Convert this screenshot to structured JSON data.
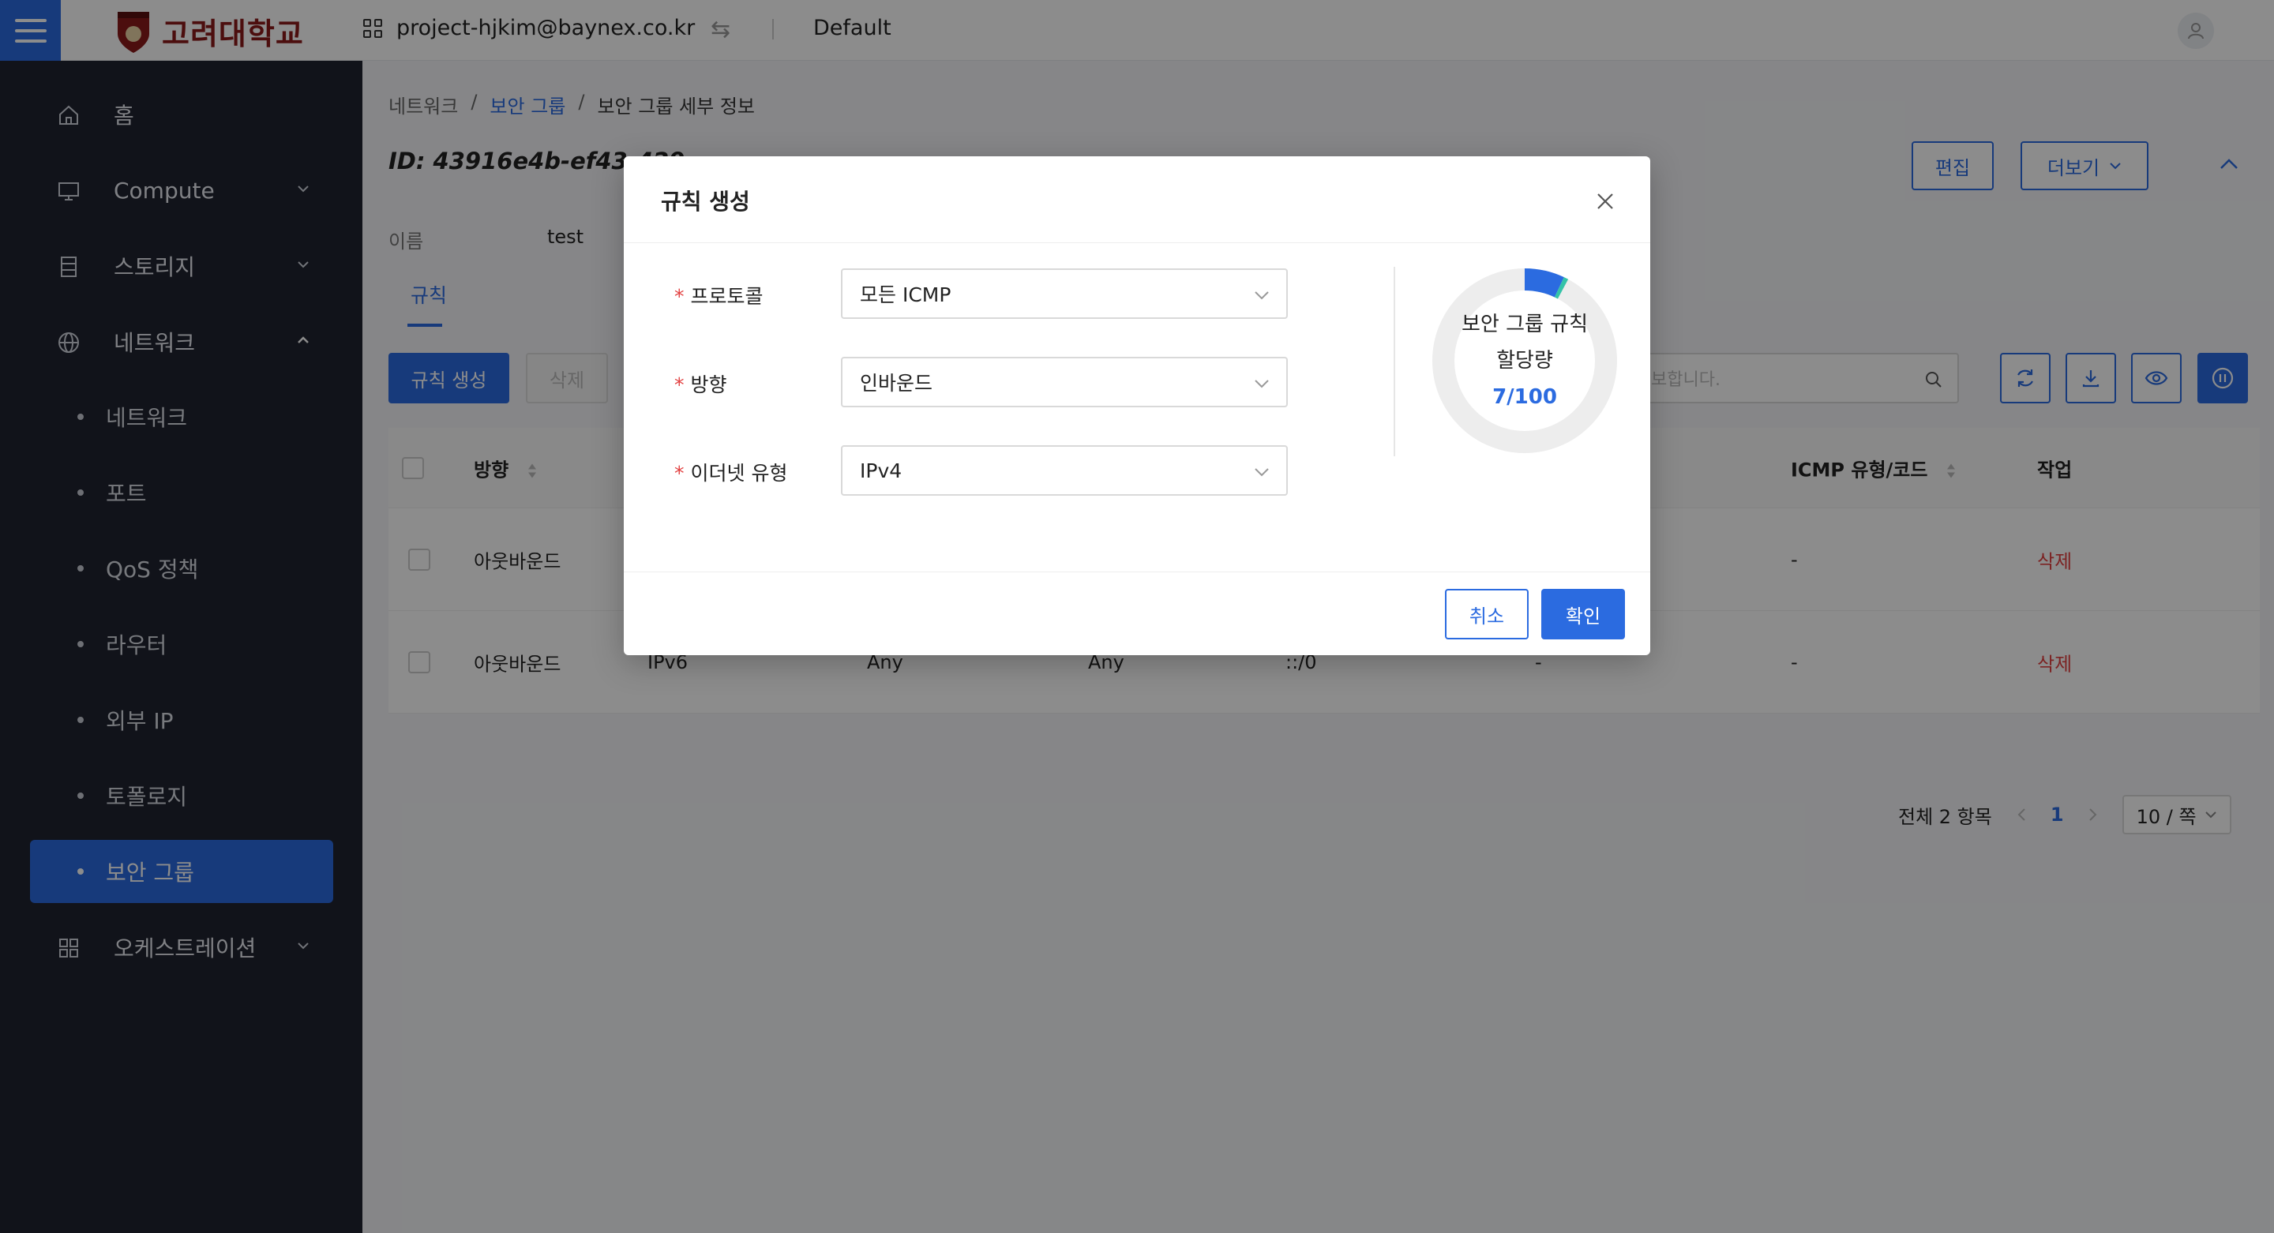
{
  "header": {
    "brand": "고려대학교",
    "project": "project-hjkim@baynex.co.kr",
    "domain": "Default"
  },
  "sidebar": {
    "items": [
      {
        "label": "홈",
        "icon": "home-icon"
      },
      {
        "label": "Compute",
        "icon": "monitor-icon"
      },
      {
        "label": "스토리지",
        "icon": "storage-icon"
      },
      {
        "label": "네트워크",
        "icon": "globe-icon"
      },
      {
        "label": "오케스트레이션",
        "icon": "grid-icon"
      }
    ],
    "network_sub": [
      "네트워크",
      "포트",
      "QoS 정책",
      "라우터",
      "외부 IP",
      "토폴로지",
      "보안 그룹"
    ]
  },
  "breadcrumb": [
    "네트워크",
    "보안 그룹",
    "보안 그룹 세부 정보"
  ],
  "breadcrumb_sep": "/",
  "detail": {
    "id_label": "ID:  43916e4b-ef43-429",
    "edit_label": "편집",
    "more_label": "더보기",
    "name_label": "이름",
    "name_value": "test",
    "tab_rules": "규칙"
  },
  "toolbar": {
    "create_label": "규칙 생성",
    "delete_label": "삭제",
    "search_placeholder": "보합니다."
  },
  "table": {
    "headers": [
      "방향",
      "ICMP 유형/코드",
      "작업"
    ],
    "rows": [
      {
        "direction": "아웃바운드",
        "ether": "",
        "proto": "",
        "port": "",
        "cidr": "",
        "remote": "",
        "icmp": "-",
        "action": "삭제"
      },
      {
        "direction": "아웃바운드",
        "ether": "IPv6",
        "proto": "Any",
        "port": "Any",
        "cidr": "::/0",
        "remote": "-",
        "icmp": "-",
        "action": "삭제"
      }
    ]
  },
  "pagination": {
    "total": "전체 2 항목",
    "page": "1",
    "page_size": "10 / 쪽"
  },
  "modal": {
    "title": "규칙 생성",
    "fields": [
      {
        "label": "프로토콜",
        "value": "모든 ICMP"
      },
      {
        "label": "방향",
        "value": "인바운드"
      },
      {
        "label": "이더넷 유형",
        "value": "IPv4"
      }
    ],
    "quota_title_1": "보안 그룹 규칙",
    "quota_title_2": "할당량",
    "quota_value": "7/100",
    "quota_used": 7,
    "quota_total": 100,
    "cancel_label": "취소",
    "ok_label": "확인"
  },
  "colors": {
    "primary": "#2b6be0",
    "sidebar_bg": "#1f2330",
    "danger": "#e24141",
    "brand": "#8b1a1a"
  }
}
